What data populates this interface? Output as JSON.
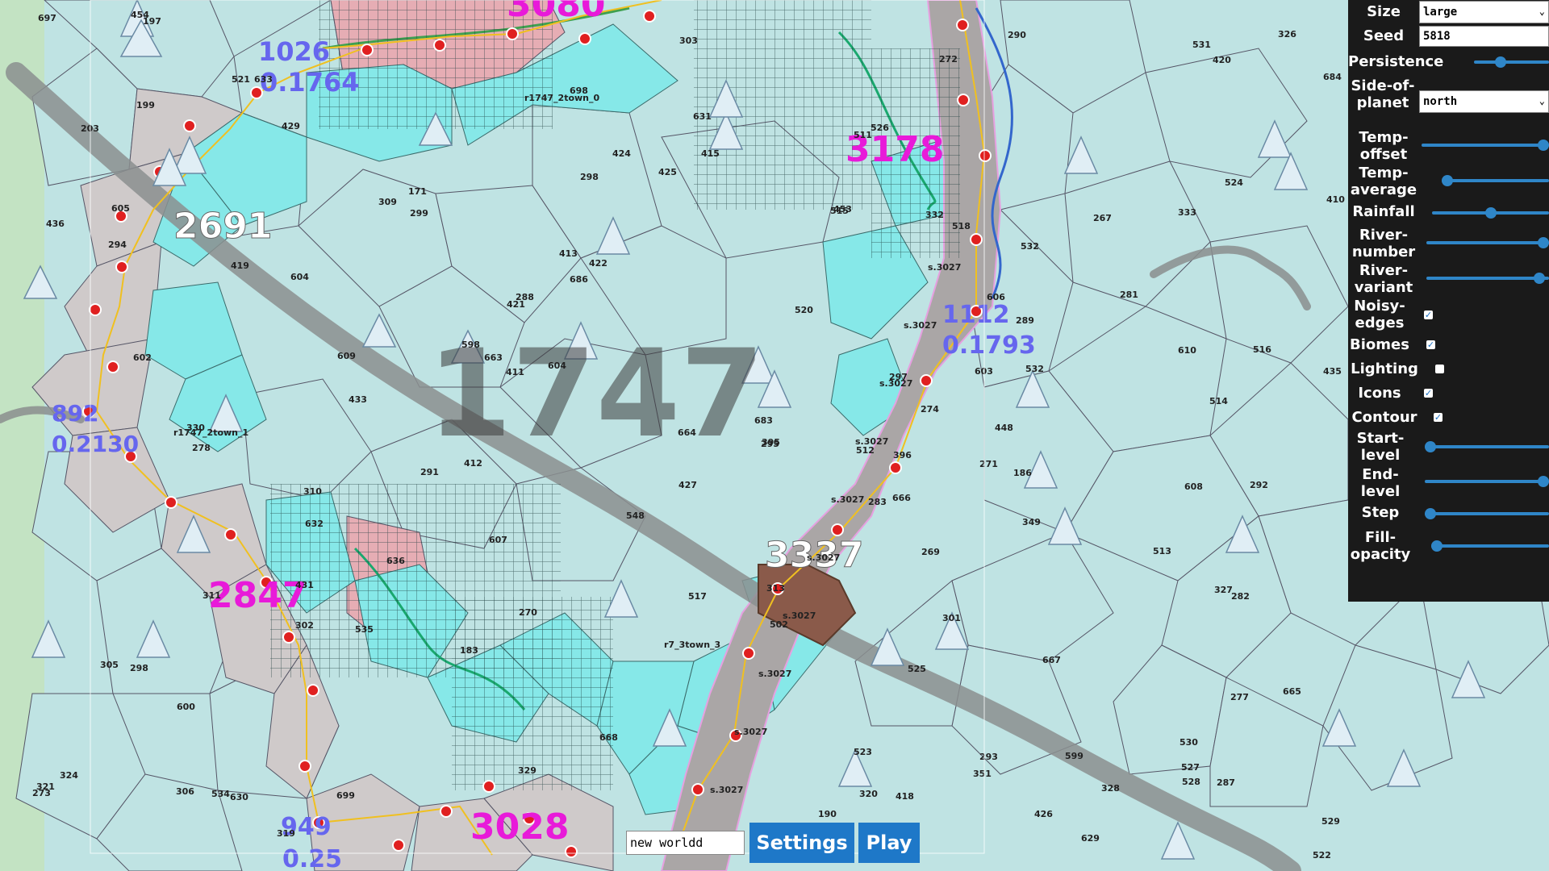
{
  "map": {
    "elevation_labels": [
      {
        "text": "3080",
        "color": "#e81ad9"
      },
      {
        "text": "1026",
        "color": "#6666ee"
      },
      {
        "text": "0.1764",
        "color": "#6666ee"
      },
      {
        "text": "2691",
        "color": "#ffffff"
      },
      {
        "text": "3178",
        "color": "#e81ad9"
      },
      {
        "text": "1112",
        "color": "#6666ee"
      },
      {
        "text": "0.1793",
        "color": "#6666ee"
      },
      {
        "text": "2847",
        "color": "#e81ad9"
      },
      {
        "text": "3337",
        "color": "#ffffff"
      },
      {
        "text": "3028",
        "color": "#e81ad9"
      },
      {
        "text": "949",
        "color": "#6666ee"
      },
      {
        "text": "0.25",
        "color": "#6666ee"
      },
      {
        "text": "892",
        "color": "#6666ee"
      },
      {
        "text": "0.2130",
        "color": "#6666ee"
      }
    ],
    "center_number": "1747",
    "cell_ids": [
      "273",
      "171",
      "271",
      "183",
      "186",
      "269",
      "267",
      "270",
      "272",
      "274",
      "277",
      "278",
      "282",
      "283",
      "287",
      "288",
      "281",
      "419",
      "422",
      "292",
      "293",
      "294",
      "295",
      "298",
      "420",
      "421",
      "418",
      "415",
      "413",
      "411",
      "412",
      "515",
      "514",
      "513",
      "512",
      "517",
      "516",
      "518",
      "520",
      "598",
      "599",
      "600",
      "602",
      "521",
      "410",
      "511",
      "548",
      "534",
      "527",
      "528",
      "532",
      "436",
      "454",
      "453",
      "448",
      "332",
      "333",
      "329",
      "330",
      "321",
      "320",
      "324",
      "319",
      "313",
      "309",
      "310",
      "305",
      "301",
      "303",
      "306",
      "311",
      "531",
      "530",
      "529",
      "532",
      "535",
      "610",
      "609",
      "608",
      "607",
      "606",
      "603",
      "604",
      "522",
      "523",
      "524",
      "526",
      "427",
      "426",
      "425",
      "424",
      "396",
      "395",
      "289",
      "290",
      "291",
      "302",
      "299",
      "297",
      "298",
      "328",
      "327",
      "326",
      "349",
      "351",
      "203",
      "199",
      "197",
      "190",
      "429",
      "431",
      "433",
      "435",
      "525",
      "604",
      "605",
      "629",
      "630",
      "631",
      "632",
      "633",
      "636",
      "683",
      "684",
      "686",
      "697",
      "698",
      "699",
      "667",
      "668",
      "665",
      "666",
      "663",
      "664",
      "502"
    ],
    "node_labels": [
      "s.3027",
      "s.3027",
      "s.3027",
      "s.3027",
      "s.3027",
      "s.3027",
      "s.3027",
      "s.3027",
      "s.3027",
      "s.3027"
    ],
    "town_labels": [
      "r1747_2town_0",
      "r1747_2town_1",
      "r7_3town_3"
    ]
  },
  "settings": {
    "size_label": "Size",
    "size_value": "large",
    "seed_label": "Seed",
    "seed_value": "5818",
    "persistence_label": "Persistence",
    "persistence_value": 0.35,
    "side_label": "Side-of-planet",
    "side_value": "north",
    "temp_offset_label": "Temp-offset",
    "temp_offset_value": 1.0,
    "temp_average_label": "Temp-average",
    "temp_average_value": 0.05,
    "rainfall_label": "Rainfall",
    "rainfall_value": 0.5,
    "river_number_label": "River-number",
    "river_number_value": 1.0,
    "river_variant_label": "River-variant",
    "river_variant_value": 0.92,
    "noisy_edges_label": "Noisy-edges",
    "noisy_edges_checked": true,
    "biomes_label": "Biomes",
    "biomes_checked": true,
    "lighting_label": "Lighting",
    "lighting_checked": false,
    "icons_label": "Icons",
    "icons_checked": true,
    "contour_label": "Contour",
    "contour_checked": true,
    "start_level_label": "Start-level",
    "start_level_value": 0.02,
    "end_level_label": "End-level",
    "end_level_value": 1.0,
    "step_label": "Step",
    "step_value": 0.02,
    "fill_opacity_label": "Fill-opacity",
    "fill_opacity_value": 0.05
  },
  "bottom": {
    "world_name_value": "new worldd",
    "settings_button": "Settings",
    "play_button": "Play"
  },
  "colors": {
    "water_cell": "#86e8e8",
    "land_cell": "#bfe3e3",
    "mountain_cell": "#c9c9c9",
    "highlight_cell": "#e4aab0",
    "panel_bg": "#1a1a1a",
    "button_bg": "#1e78c8",
    "accent_magenta": "#e81ad9"
  }
}
